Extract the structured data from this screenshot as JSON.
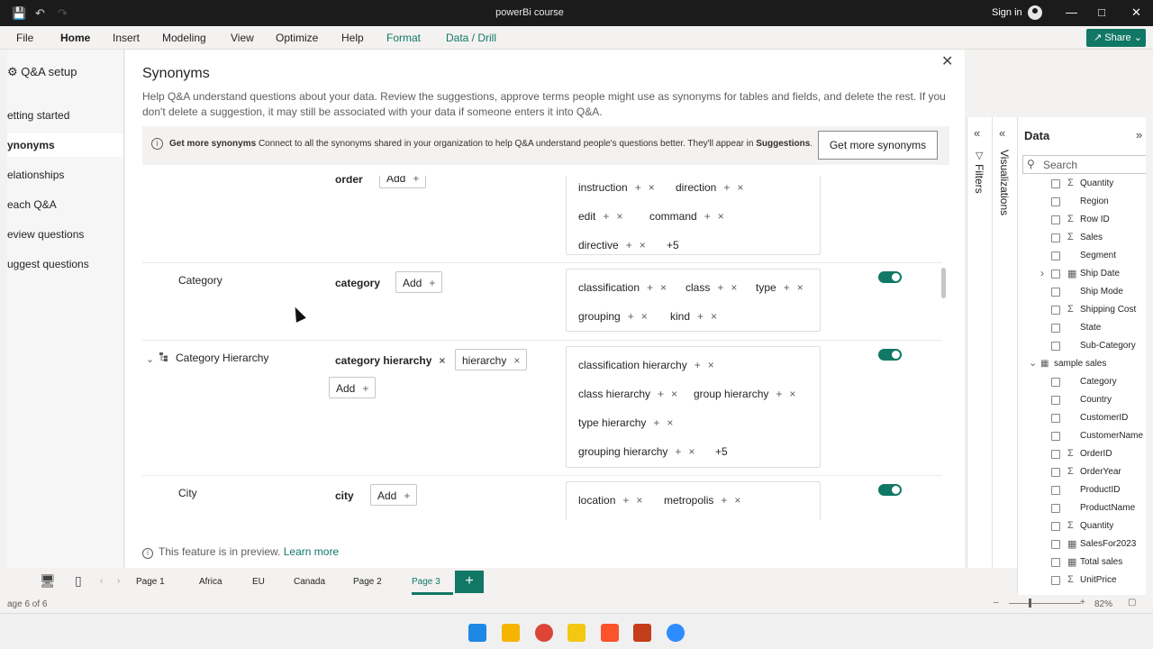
{
  "window": {
    "title": "powerBi course",
    "sign_in": "Sign in"
  },
  "ribbon": {
    "tabs": [
      "File",
      "Home",
      "Insert",
      "Modeling",
      "View",
      "Optimize",
      "Help",
      "Format",
      "Data / Drill"
    ],
    "share": "Share"
  },
  "leftnav": {
    "title": "Q&A setup",
    "items": [
      "etting started",
      "ynonyms",
      "elationships",
      "each Q&A",
      "eview questions",
      "uggest questions"
    ]
  },
  "dialog": {
    "title": "Synonyms",
    "description": "Help Q&A understand questions about your data. Review the suggestions, approve terms people might use as synonyms for tables and fields, and delete the rest. If you don't delete a suggestion, it may still be associated with your data if someone enters it into Q&A.",
    "info": {
      "bold": "Get more synonyms",
      "text": "Connect to all the synonyms shared in your organization to help Q&A understand people's questions better. They'll appear in",
      "bold_end": "Suggestions",
      "button": "Get more synonyms"
    },
    "add_label": "Add",
    "rows": {
      "order": {
        "term": "order",
        "suggestions": [
          "instruction",
          "direction",
          "edit",
          "command",
          "directive"
        ],
        "more": "+5"
      },
      "category": {
        "name": "Category",
        "term": "category",
        "suggestions": [
          "classification",
          "class",
          "type",
          "grouping",
          "kind"
        ]
      },
      "category_hierarchy": {
        "name": "Category Hierarchy",
        "terms": [
          "category hierarchy",
          "hierarchy"
        ],
        "suggestions": [
          "classification hierarchy",
          "class hierarchy",
          "group hierarchy",
          "type hierarchy",
          "grouping hierarchy"
        ],
        "more": "+5"
      },
      "city": {
        "name": "City",
        "term": "city",
        "suggestions": [
          "location",
          "metropolis"
        ]
      }
    },
    "footer": {
      "text": "This feature is in preview.",
      "link": "Learn more"
    }
  },
  "panes": {
    "filters": "Filters",
    "visualizations": "Visualizations"
  },
  "data_pane": {
    "title": "Data",
    "search_placeholder": "Search",
    "fields_top": [
      {
        "name": "Quantity",
        "sigma": true
      },
      {
        "name": "Region",
        "sigma": false
      },
      {
        "name": "Row ID",
        "sigma": true
      },
      {
        "name": "Sales",
        "sigma": true
      },
      {
        "name": "Segment",
        "sigma": false
      },
      {
        "name": "Ship Date",
        "sigma": false,
        "date": true
      },
      {
        "name": "Ship Mode",
        "sigma": false
      },
      {
        "name": "Shipping Cost",
        "sigma": true
      },
      {
        "name": "State",
        "sigma": false
      },
      {
        "name": "Sub-Category",
        "sigma": false
      }
    ],
    "table_name": "sample sales",
    "fields_table": [
      {
        "name": "Category",
        "sigma": false
      },
      {
        "name": "Country",
        "sigma": false
      },
      {
        "name": "CustomerID",
        "sigma": false
      },
      {
        "name": "CustomerName",
        "sigma": false
      },
      {
        "name": "OrderID",
        "sigma": true
      },
      {
        "name": "OrderYear",
        "sigma": true
      },
      {
        "name": "ProductID",
        "sigma": false
      },
      {
        "name": "ProductName",
        "sigma": false
      },
      {
        "name": "Quantity",
        "sigma": true
      },
      {
        "name": "SalesFor2023",
        "sigma": false,
        "table_icon": true
      },
      {
        "name": "Total sales",
        "sigma": false,
        "table_icon": true
      },
      {
        "name": "UnitPrice",
        "sigma": true
      }
    ]
  },
  "pages": [
    "Page 1",
    "Africa",
    "EU",
    "Canada",
    "Page 2",
    "Page 3"
  ],
  "status": {
    "page": "age 6 of 6",
    "zoom": "82%"
  },
  "colors": {
    "accent": "#117865",
    "titlebar": "#1b1b1b"
  }
}
